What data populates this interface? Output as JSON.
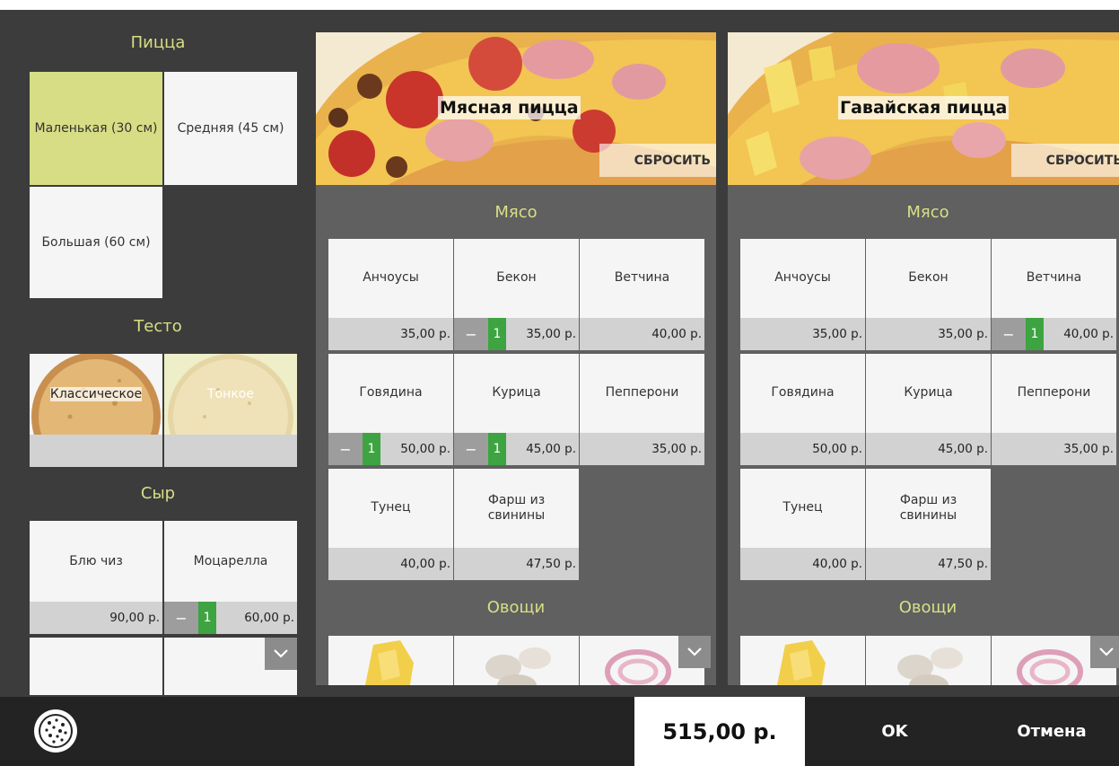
{
  "left": {
    "size_title": "Пицца",
    "sizes": [
      "Маленькая (30 см)",
      "Средняя (45 см)",
      "Большая (60 см)"
    ],
    "dough_title": "Тесто",
    "doughs": [
      "Классическое",
      "Тонкое"
    ],
    "cheese_title": "Сыр",
    "cheeses": [
      {
        "name": "Блю чиз",
        "price": "90,00 р.",
        "qty": ""
      },
      {
        "name": "Моцарелла",
        "price": "60,00 р.",
        "qty": "1"
      }
    ]
  },
  "panels": [
    {
      "title": "Мясная пицца",
      "reset": "СБРОСИТЬ",
      "meat_title": "Мясо",
      "veg_title": "Овощи",
      "items": [
        {
          "name": "Анчоусы",
          "price": "35,00 р.",
          "qty": ""
        },
        {
          "name": "Бекон",
          "price": "35,00 р.",
          "qty": "1"
        },
        {
          "name": "Ветчина",
          "price": "40,00 р.",
          "qty": ""
        },
        {
          "name": "Говядина",
          "price": "50,00 р.",
          "qty": "1"
        },
        {
          "name": "Курица",
          "price": "45,00 р.",
          "qty": "1"
        },
        {
          "name": "Пепперони",
          "price": "35,00 р.",
          "qty": ""
        },
        {
          "name": "Тунец",
          "price": "40,00 р.",
          "qty": ""
        },
        {
          "name": "Фарш из свинины",
          "price": "47,50 р.",
          "qty": ""
        }
      ]
    },
    {
      "title": "Гавайская пицца",
      "reset": "СБРОСИТЬ",
      "meat_title": "Мясо",
      "veg_title": "Овощи",
      "items": [
        {
          "name": "Анчоусы",
          "price": "35,00 р.",
          "qty": ""
        },
        {
          "name": "Бекон",
          "price": "35,00 р.",
          "qty": ""
        },
        {
          "name": "Ветчина",
          "price": "40,00 р.",
          "qty": "1"
        },
        {
          "name": "Говядина",
          "price": "50,00 р.",
          "qty": ""
        },
        {
          "name": "Курица",
          "price": "45,00 р.",
          "qty": ""
        },
        {
          "name": "Пепперони",
          "price": "35,00 р.",
          "qty": ""
        },
        {
          "name": "Тунец",
          "price": "40,00 р.",
          "qty": ""
        },
        {
          "name": "Фарш из свинины",
          "price": "47,50 р.",
          "qty": ""
        }
      ]
    }
  ],
  "footer": {
    "total": "515,00 р.",
    "ok": "OK",
    "cancel": "Отмена"
  },
  "colors": {
    "accent": "#d9df86",
    "selected": "#d7dd84",
    "qty_green": "#3da441"
  },
  "icons": {
    "pizza": "pizza-icon",
    "chevron": "chevron-down-icon",
    "minus": "minus-icon"
  }
}
